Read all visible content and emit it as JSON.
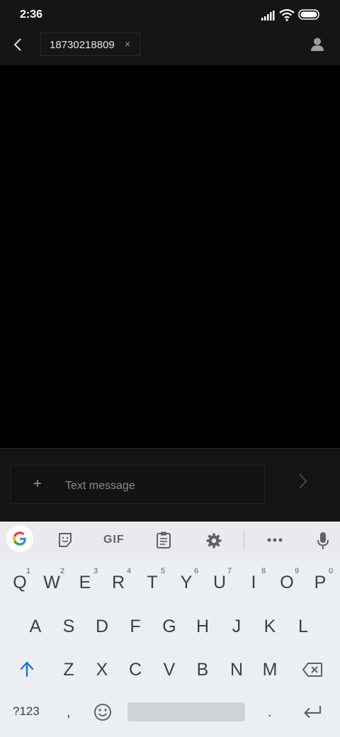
{
  "status_bar": {
    "time": "2:36"
  },
  "header": {
    "recipient": "18730218809",
    "remove_symbol": "×"
  },
  "composer": {
    "placeholder": "Text message",
    "add_symbol": "+"
  },
  "keyboard": {
    "toolbar": {
      "gif_label": "GIF"
    },
    "row1": [
      "Q",
      "W",
      "E",
      "R",
      "T",
      "Y",
      "U",
      "I",
      "O",
      "P"
    ],
    "row1_hints": [
      "1",
      "2",
      "3",
      "4",
      "5",
      "6",
      "7",
      "8",
      "9",
      "0"
    ],
    "row2": [
      "A",
      "S",
      "D",
      "F",
      "G",
      "H",
      "J",
      "K",
      "L"
    ],
    "row3": [
      "Z",
      "X",
      "C",
      "V",
      "B",
      "N",
      "M"
    ],
    "bottom": {
      "symbols": "?123",
      "comma": ",",
      "period": "."
    }
  },
  "colors": {
    "accent": "#1a73e8",
    "dark_bg": "#151515"
  }
}
